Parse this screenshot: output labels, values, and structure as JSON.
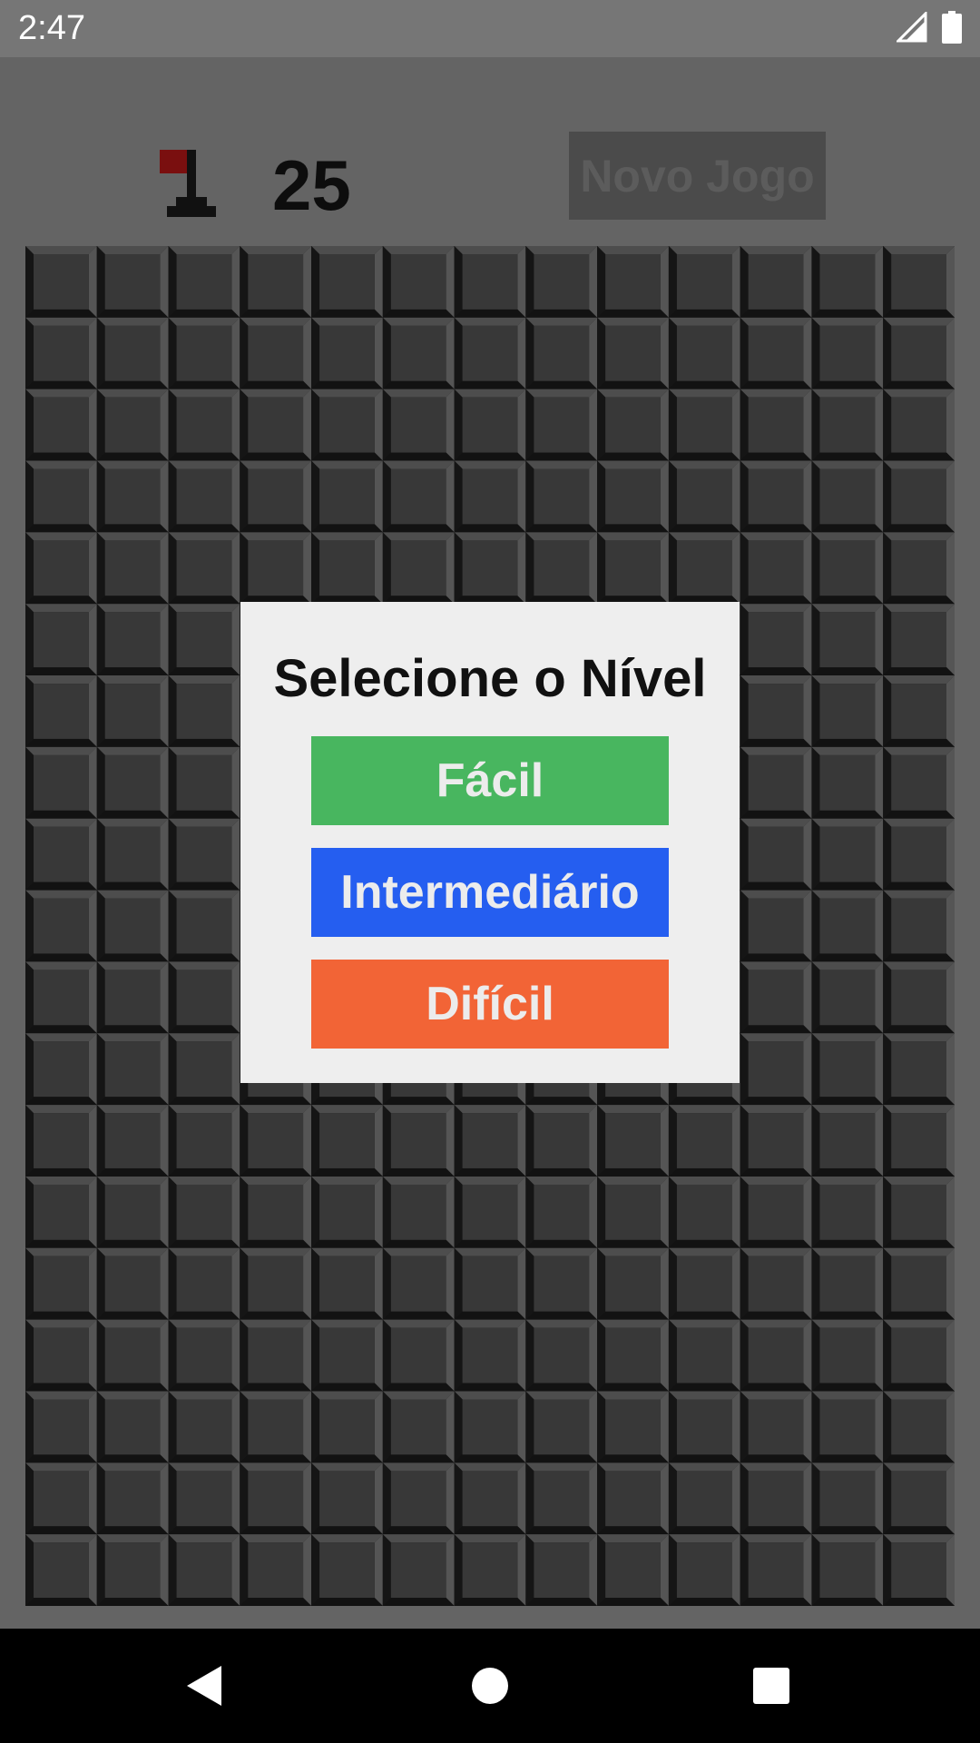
{
  "status_bar": {
    "time": "2:47",
    "icons": [
      "signal-icon",
      "battery-icon"
    ]
  },
  "header": {
    "flag_icon": "flag-icon",
    "mine_counter": "25",
    "new_game_label": "Novo Jogo"
  },
  "board": {
    "columns": 13,
    "rows": 19,
    "cell_state": "covered"
  },
  "dialog": {
    "title": "Selecione o Nível",
    "buttons": [
      {
        "label": "Fácil",
        "color": "#48b65f"
      },
      {
        "label": "Intermediário",
        "color": "#255ef0"
      },
      {
        "label": "Difícil",
        "color": "#f26436"
      }
    ]
  },
  "nav_bar": {
    "icons": [
      "back-icon",
      "home-icon",
      "recents-icon"
    ]
  },
  "colors": {
    "status_bar": "#767676",
    "background": "#646464",
    "cell_face": "#383838",
    "dialog_bg": "#eeeeee",
    "flag_red": "#7a0f0f"
  }
}
